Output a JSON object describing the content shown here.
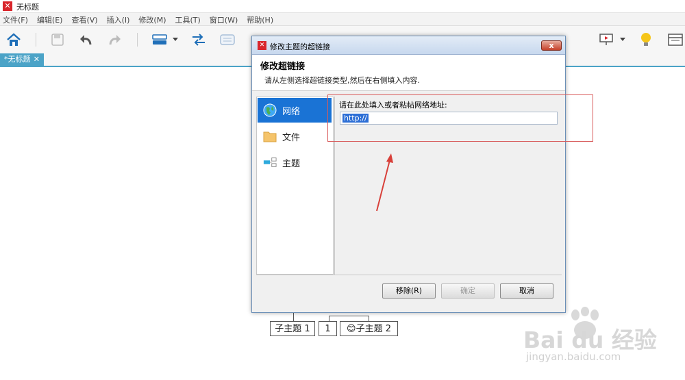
{
  "window": {
    "title": "无标题",
    "logo_glyph": "✕"
  },
  "menubar": {
    "items": [
      "文件(F)",
      "编辑(E)",
      "查看(V)",
      "插入(I)",
      "修改(M)",
      "工具(T)",
      "窗口(W)",
      "帮助(H)"
    ]
  },
  "toolbar": {
    "icons": [
      "home-icon",
      "save-icon",
      "undo-icon",
      "redo-icon",
      "topic-icon",
      "dropdown-arrow-icon",
      "relationship-icon",
      "boundary-icon",
      "presentation-icon",
      "idea-bulb-icon",
      "panel-toggle-icon"
    ]
  },
  "tabs": {
    "doc_tab_label": "*无标题",
    "close_glyph": "✕"
  },
  "canvas": {
    "nodes": [
      "子主题 1",
      "1",
      "子主题 2"
    ],
    "node2_emoji": "😊"
  },
  "dialog": {
    "title": "修改主题的超链接",
    "close_glyph": "x",
    "heading": "修改超链接",
    "description": "请从左侧选择超链接类型,然后在右侧填入内容.",
    "categories": [
      {
        "label": "网络",
        "icon": "globe-icon",
        "selected": true
      },
      {
        "label": "文件",
        "icon": "folder-icon",
        "selected": false
      },
      {
        "label": "主题",
        "icon": "topic-link-icon",
        "selected": false
      }
    ],
    "url_label": "请在此处填入或者粘帖网络地址:",
    "url_value": "http://",
    "buttons": {
      "remove": "移除(R)",
      "ok": "确定",
      "cancel": "取消"
    }
  },
  "watermark": {
    "brand": "Bai  du 经验",
    "url": "jingyan.baidu.com"
  },
  "colors": {
    "accent": "#4ba3c7",
    "selected": "#1a73d5",
    "annotation": "#d85a5a",
    "logo": "#d9262c"
  }
}
